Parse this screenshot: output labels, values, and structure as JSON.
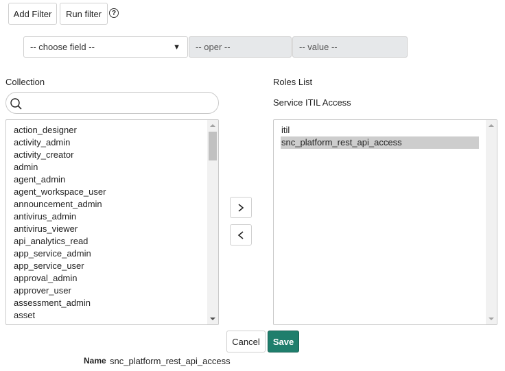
{
  "filter": {
    "add_filter_label": "Add Filter",
    "run_filter_label": "Run filter",
    "help_icon": "?",
    "field_placeholder": "-- choose field --",
    "oper_placeholder": "-- oper --",
    "value_placeholder": "-- value --"
  },
  "collection": {
    "label": "Collection",
    "search_placeholder": "",
    "items": [
      "action_designer",
      "activity_admin",
      "activity_creator",
      "admin",
      "agent_admin",
      "agent_workspace_user",
      "announcement_admin",
      "antivirus_admin",
      "antivirus_viewer",
      "api_analytics_read",
      "app_service_admin",
      "app_service_user",
      "approval_admin",
      "approver_user",
      "assessment_admin",
      "asset"
    ]
  },
  "roles": {
    "label": "Roles List",
    "subtitle": "Service ITIL Access",
    "items": [
      "itil",
      "snc_platform_rest_api_access"
    ],
    "selected": "snc_platform_rest_api_access"
  },
  "actions": {
    "add_arrow": "›",
    "remove_arrow": "‹",
    "cancel_label": "Cancel",
    "save_label": "Save",
    "save_color": "#1f7e6c"
  },
  "footer": {
    "name_label": "Name",
    "name_value": "snc_platform_rest_api_access"
  }
}
